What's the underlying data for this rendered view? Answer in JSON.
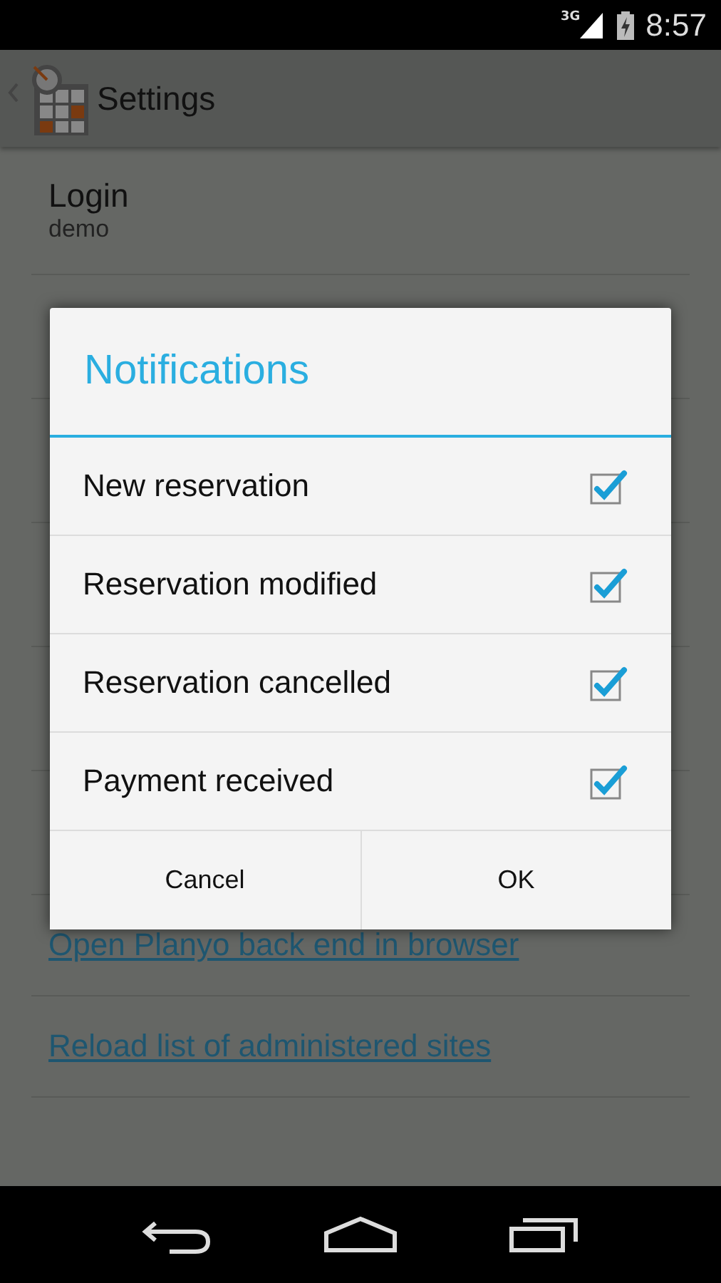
{
  "status_bar": {
    "network": "3G",
    "time": "8:57"
  },
  "action_bar": {
    "title": "Settings"
  },
  "settings": [
    {
      "kind": "field",
      "label": "Login",
      "value": "demo"
    },
    {
      "kind": "blank"
    },
    {
      "kind": "blank"
    },
    {
      "kind": "blank"
    },
    {
      "kind": "blank"
    },
    {
      "kind": "blank"
    },
    {
      "kind": "link",
      "label": "Open Planyo back end in browser"
    },
    {
      "kind": "link",
      "label": "Reload list of administered sites"
    }
  ],
  "dialog": {
    "title": "Notifications",
    "items": [
      {
        "label": "New reservation",
        "checked": true
      },
      {
        "label": "Reservation modified",
        "checked": true
      },
      {
        "label": "Reservation cancelled",
        "checked": true
      },
      {
        "label": "Payment received",
        "checked": true
      }
    ],
    "buttons": [
      "Cancel",
      "OK"
    ]
  }
}
